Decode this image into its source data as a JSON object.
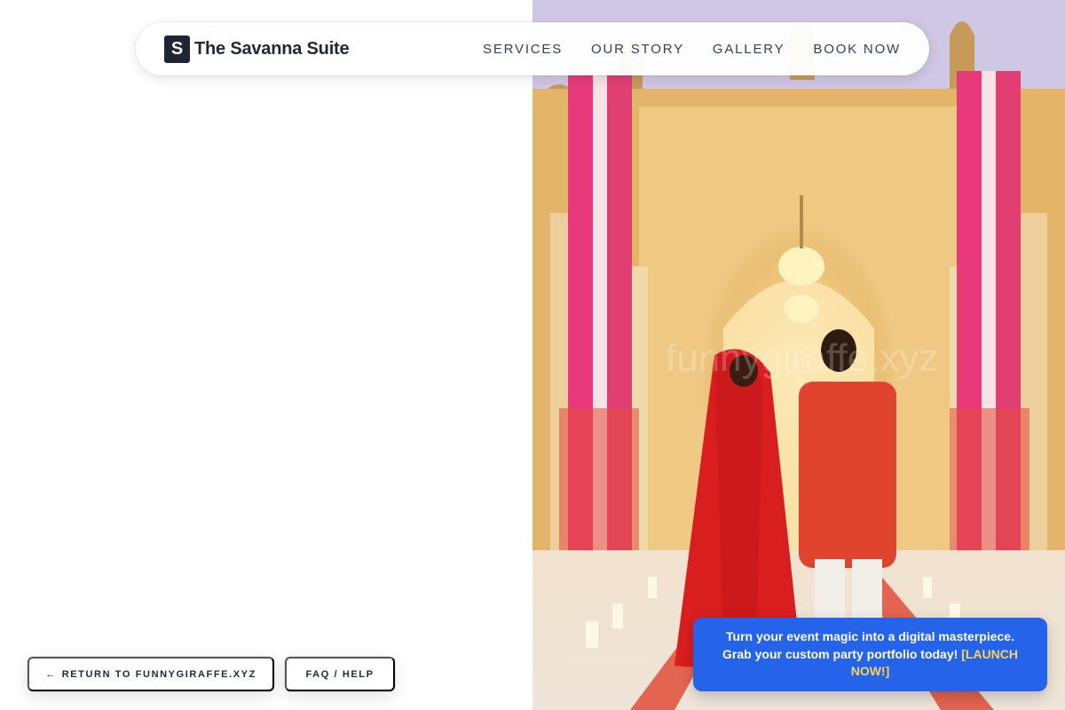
{
  "brand": {
    "mark": "S",
    "name": "The Savanna Suite"
  },
  "nav": {
    "links": [
      {
        "label": "SERVICES"
      },
      {
        "label": "OUR STORY"
      },
      {
        "label": "GALLERY"
      },
      {
        "label": "BOOK NOW"
      }
    ]
  },
  "hero": {
    "watermark": "funnygiraffe.xyz"
  },
  "buttons": {
    "return_arrow": "←",
    "return_label": "RETURN TO FUNNYGIRAFFE.XYZ",
    "faq_label": "FAQ / HELP"
  },
  "promo": {
    "line1": "Turn your event magic into a digital masterpiece.",
    "line2": "Grab your custom party portfolio today!",
    "cta": "[LAUNCH NOW!]"
  },
  "colors": {
    "promo_bg": "#2563eb",
    "promo_cta": "#fcd34d",
    "brand_mark_bg": "#1e2636"
  }
}
